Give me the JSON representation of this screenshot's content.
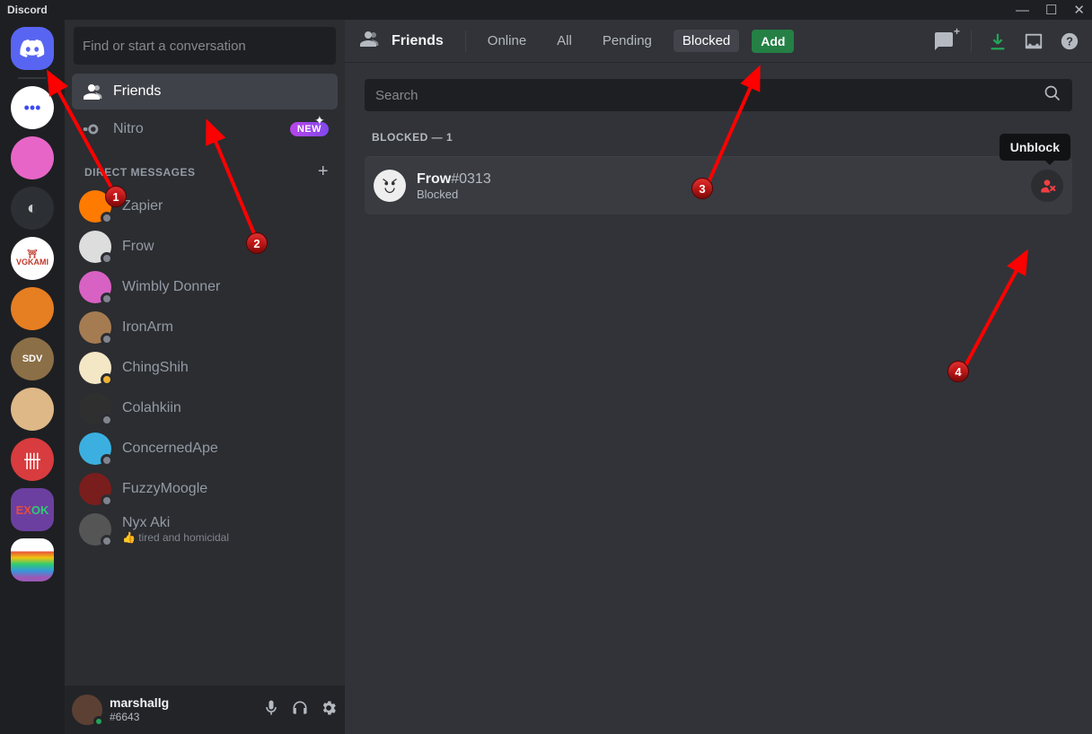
{
  "titlebar": {
    "title": "Discord"
  },
  "channels": {
    "find_placeholder": "Find or start a conversation",
    "friends_label": "Friends",
    "nitro_label": "Nitro",
    "nitro_badge": "NEW",
    "dm_header": "DIRECT MESSAGES",
    "dms": [
      {
        "name": "Zapier",
        "avatar": "orange"
      },
      {
        "name": "Frow",
        "avatar": "white"
      },
      {
        "name": "Wimbly Donner",
        "avatar": "pink"
      },
      {
        "name": "IronArm",
        "avatar": "brown"
      },
      {
        "name": "ChingShih",
        "avatar": "cream",
        "badge": true
      },
      {
        "name": "Colahkiin",
        "avatar": "dark"
      },
      {
        "name": "ConcernedApe",
        "avatar": "blue"
      },
      {
        "name": "FuzzyMoogle",
        "avatar": "maroon"
      },
      {
        "name": "Nyx Aki",
        "avatar": "gray",
        "sub": "👍 tired and homicidal"
      }
    ]
  },
  "userbar": {
    "name": "marshallg",
    "tag": "#6643"
  },
  "topbar": {
    "title": "Friends",
    "tabs": {
      "online": "Online",
      "all": "All",
      "pending": "Pending",
      "blocked": "Blocked"
    },
    "add_friend": "Add"
  },
  "content": {
    "search_placeholder": "Search",
    "section_header": "BLOCKED — 1",
    "blocked_user": {
      "name": "Frow",
      "discriminator": "#0313",
      "status": "Blocked"
    },
    "unblock_tooltip": "Unblock"
  },
  "markers": {
    "m1": "1",
    "m2": "2",
    "m3": "3",
    "m4": "4"
  }
}
